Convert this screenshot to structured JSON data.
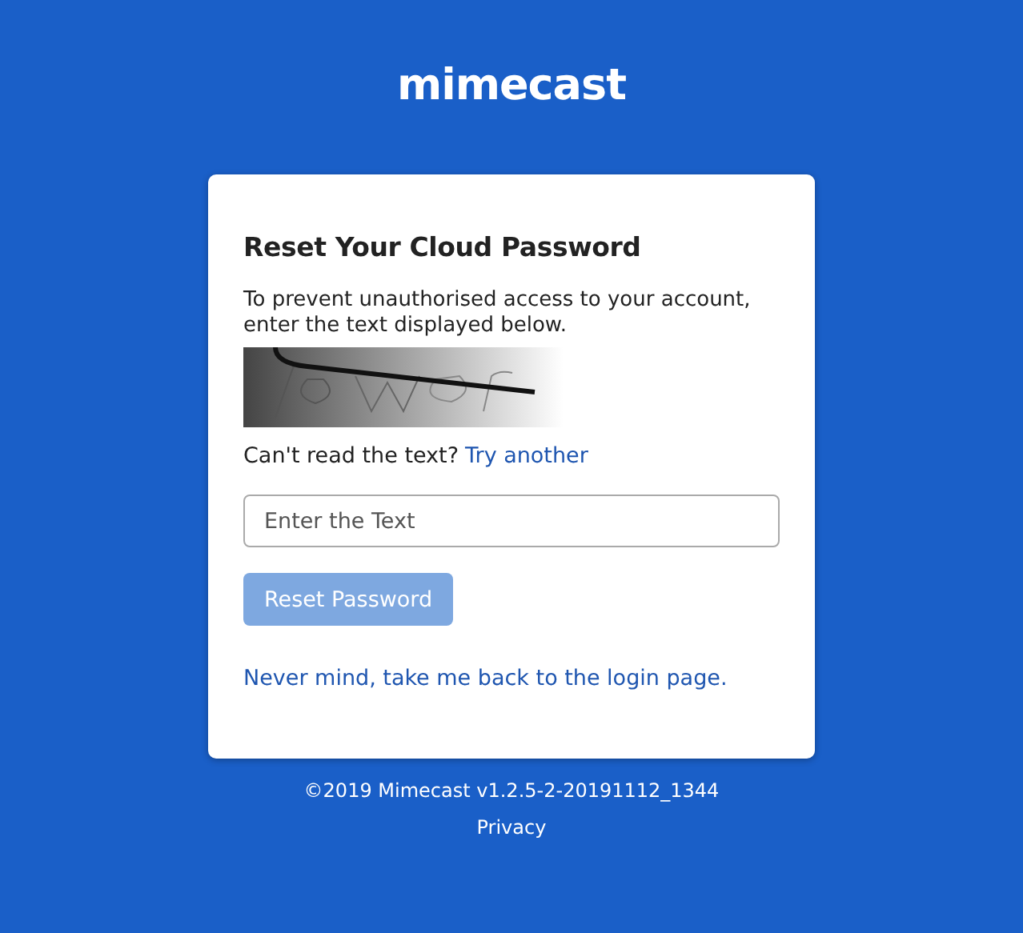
{
  "logo": "mimecast",
  "card": {
    "title": "Reset Your Cloud Password",
    "instructions": "To prevent unauthorised access to your account, enter the text displayed below.",
    "retry_prompt": "Can't read the text?",
    "retry_link": "Try another",
    "field": {
      "placeholder": "Enter the Text"
    },
    "button": {
      "label": "Reset Password",
      "disabled": true
    },
    "back_link": "Never mind, take me back to the login page."
  },
  "footer": {
    "copyright": "©2019 Mimecast v1.2.5-2-20191112_1344",
    "privacy": "Privacy"
  }
}
